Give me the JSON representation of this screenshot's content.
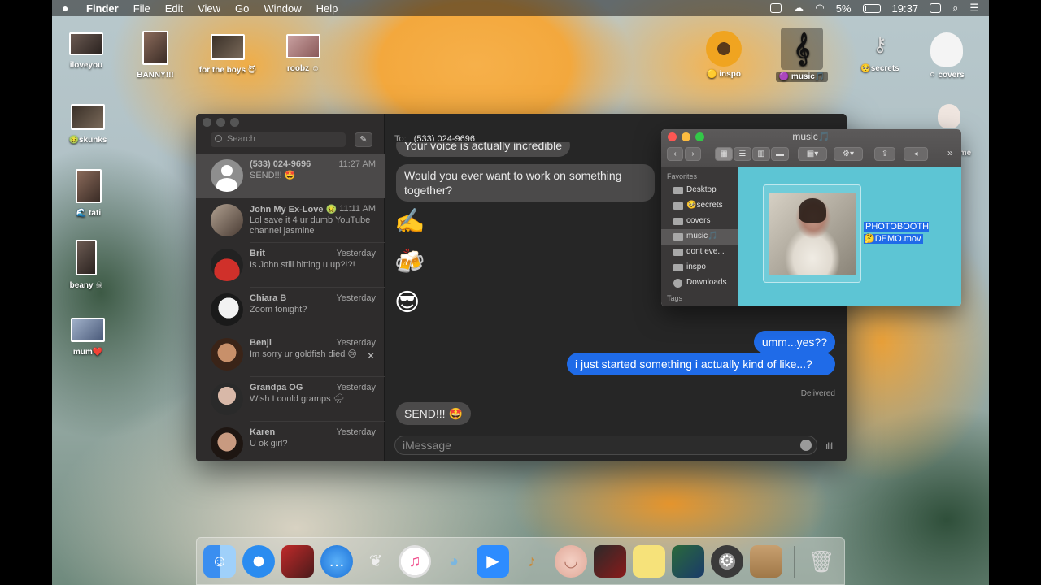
{
  "menubar": {
    "app": "Finder",
    "items": [
      "File",
      "Edit",
      "View",
      "Go",
      "Window",
      "Help"
    ],
    "battery": "5%",
    "time": "19:37"
  },
  "desktop_icons": [
    {
      "label": "iloveyou"
    },
    {
      "label": "BANNY!!!"
    },
    {
      "label": "for the boys 😈"
    },
    {
      "label": "roobz ☺"
    },
    {
      "label": "🤢skunks"
    },
    {
      "label": "🌊 tati"
    },
    {
      "label": "beany ☠"
    },
    {
      "label": "mum❤️"
    },
    {
      "label": "🟡 inspo"
    },
    {
      "label": "🟣 music🎵"
    },
    {
      "label": "🥺secrets"
    },
    {
      "label": "⚪ covers"
    },
    {
      "label": "me"
    }
  ],
  "messages": {
    "search_placeholder": "Search",
    "to_label": "To:",
    "to_number": "(533) 024-9696",
    "conversations": [
      {
        "name": "(533) 024-9696",
        "time": "11:27 AM",
        "preview": "SEND!!! 🤩"
      },
      {
        "name": "John My Ex-Love 🤢",
        "time": "11:11 AM",
        "preview": "Lol save it 4 ur dumb YouTube channel jasmine"
      },
      {
        "name": "Brit",
        "time": "Yesterday",
        "preview": "Is John still hitting u up?!?!"
      },
      {
        "name": "Chiara B",
        "time": "Yesterday",
        "preview": "Zoom tonight?"
      },
      {
        "name": "Benji",
        "time": "Yesterday",
        "preview": "Im sorry ur goldfish died 😢"
      },
      {
        "name": "Grandpa OG",
        "time": "Yesterday",
        "preview": "Wish I could gramps 🌧"
      },
      {
        "name": "Karen",
        "time": "Yesterday",
        "preview": "U ok girl?"
      }
    ],
    "thread": {
      "cut_bubble": "Your voice is actually incredible",
      "in_1": "Would you ever want to work on something together?",
      "emoji_1": "✍️",
      "emoji_2": "🍻",
      "emoji_3": "😎",
      "out_1": "umm...yes??",
      "out_2": "i just started something i actually kind of like...?",
      "delivered": "Delivered",
      "in_2": "SEND!!! 🤩"
    },
    "input_placeholder": "iMessage"
  },
  "finder": {
    "title": "music🎵",
    "sidebar_heading": "Favorites",
    "sidebar_items": [
      "Desktop",
      "🥺secrets",
      "covers",
      "music🎵",
      "dont eve...",
      "inspo",
      "Downloads"
    ],
    "tags_heading": "Tags",
    "file_label": "PHOTOBOOTH 🤔DEMO.mov"
  }
}
